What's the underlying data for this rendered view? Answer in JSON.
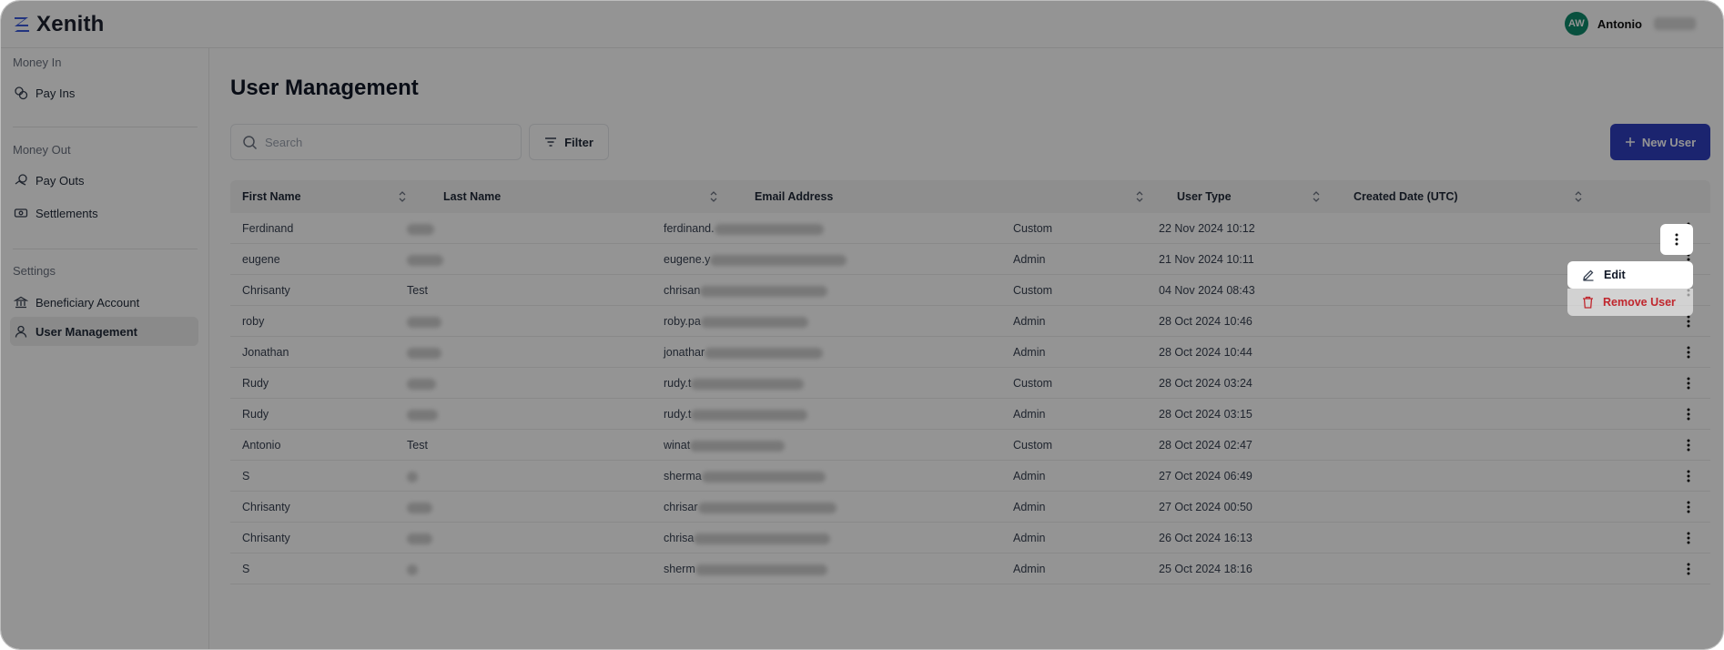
{
  "app": {
    "name": "Xenith"
  },
  "user": {
    "initials": "AW",
    "name": "Antonio"
  },
  "sidebar": {
    "sections": [
      {
        "title": "Money In",
        "items": [
          {
            "label": "Pay Ins",
            "icon": "coins-icon"
          }
        ]
      },
      {
        "title": "Money Out",
        "items": [
          {
            "label": "Pay Outs",
            "icon": "payout-icon"
          },
          {
            "label": "Settlements",
            "icon": "cash-icon"
          }
        ]
      },
      {
        "title": "Settings",
        "items": [
          {
            "label": "Beneficiary Account",
            "icon": "bank-icon"
          },
          {
            "label": "User Management",
            "icon": "user-icon",
            "active": true
          }
        ]
      }
    ]
  },
  "main": {
    "title": "User Management",
    "search_placeholder": "Search",
    "filter_label": "Filter",
    "new_user_label": "New User",
    "columns": [
      "First Name",
      "Last Name",
      "Email Address",
      "User Type",
      "Created Date (UTC)"
    ],
    "rows": [
      {
        "first": "Ferdinand",
        "last": "",
        "email": "ferdinand.",
        "type": "Custom",
        "created": "22 Nov 2024 10:12"
      },
      {
        "first": "eugene",
        "last": "",
        "email": "eugene.y",
        "type": "Admin",
        "created": "21 Nov 2024 10:11"
      },
      {
        "first": "Chrisanty",
        "last": "Test",
        "email": "chrisan",
        "type": "Custom",
        "created": "04 Nov 2024 08:43"
      },
      {
        "first": "roby",
        "last": "",
        "email": "roby.pa",
        "type": "Admin",
        "created": "28 Oct 2024 10:46"
      },
      {
        "first": "Jonathan",
        "last": "",
        "email": "jonathar",
        "type": "Admin",
        "created": "28 Oct 2024 10:44"
      },
      {
        "first": "Rudy",
        "last": "",
        "email": "rudy.t",
        "type": "Custom",
        "created": "28 Oct 2024 03:24"
      },
      {
        "first": "Rudy",
        "last": "",
        "email": "rudy.t",
        "type": "Admin",
        "created": "28 Oct 2024 03:15"
      },
      {
        "first": "Antonio",
        "last": "Test",
        "email": "winat",
        "type": "Custom",
        "created": "28 Oct 2024 02:47"
      },
      {
        "first": "S",
        "last": "",
        "email": "sherma",
        "type": "Admin",
        "created": "27 Oct 2024 06:49"
      },
      {
        "first": "Chrisanty",
        "last": "",
        "email": "chrisar",
        "type": "Admin",
        "created": "27 Oct 2024 00:50"
      },
      {
        "first": "Chrisanty",
        "last": "",
        "email": "chrisa",
        "type": "Admin",
        "created": "26 Oct 2024 16:13"
      },
      {
        "first": "S",
        "last": "",
        "email": "sherm",
        "type": "Admin",
        "created": "25 Oct 2024 18:16"
      }
    ],
    "row_menu": {
      "edit_label": "Edit",
      "remove_label": "Remove User"
    }
  },
  "colors": {
    "brand": "#2f3fbf",
    "danger": "#c0262d",
    "avatar": "#0f8a6b"
  }
}
